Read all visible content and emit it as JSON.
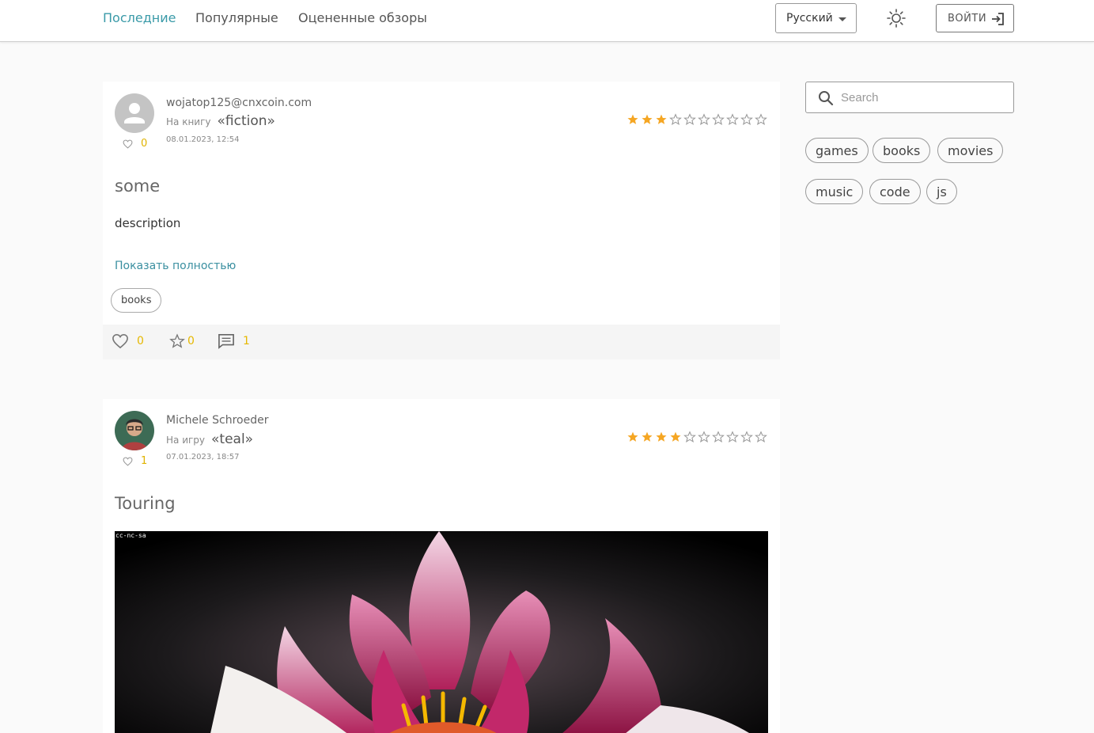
{
  "nav": {
    "latest": "Последние",
    "popular": "Популярные",
    "rated": "Оцененные обзоры"
  },
  "language": {
    "selected": "Русский"
  },
  "login": {
    "label": "ВОЙТИ"
  },
  "search": {
    "placeholder": "Search"
  },
  "tags_cloud": [
    "games",
    "books",
    "movies",
    "music",
    "code",
    "js"
  ],
  "reviews": [
    {
      "author": "wojatop125@cnxcoin.com",
      "target_prefix": "На книгу",
      "target_name": "«fiction»",
      "date": "08.01.2023, 12:54",
      "author_likes": "0",
      "rating": 3,
      "rating_max": 10,
      "title": "some",
      "description": "description",
      "show_more": "Показать полностью",
      "tag": "books",
      "likes": "0",
      "stars": "0",
      "comments": "1"
    },
    {
      "author": "Michele Schroeder",
      "target_prefix": "На игру",
      "target_name": "«teal»",
      "date": "07.01.2023, 18:57",
      "author_likes": "1",
      "rating": 4,
      "rating_max": 10,
      "title": "Touring",
      "image_badge": "cc-nc-sa"
    }
  ],
  "colors": {
    "accent": "#3a9aa8",
    "star": "#f5a623",
    "count": "#e6b800"
  }
}
